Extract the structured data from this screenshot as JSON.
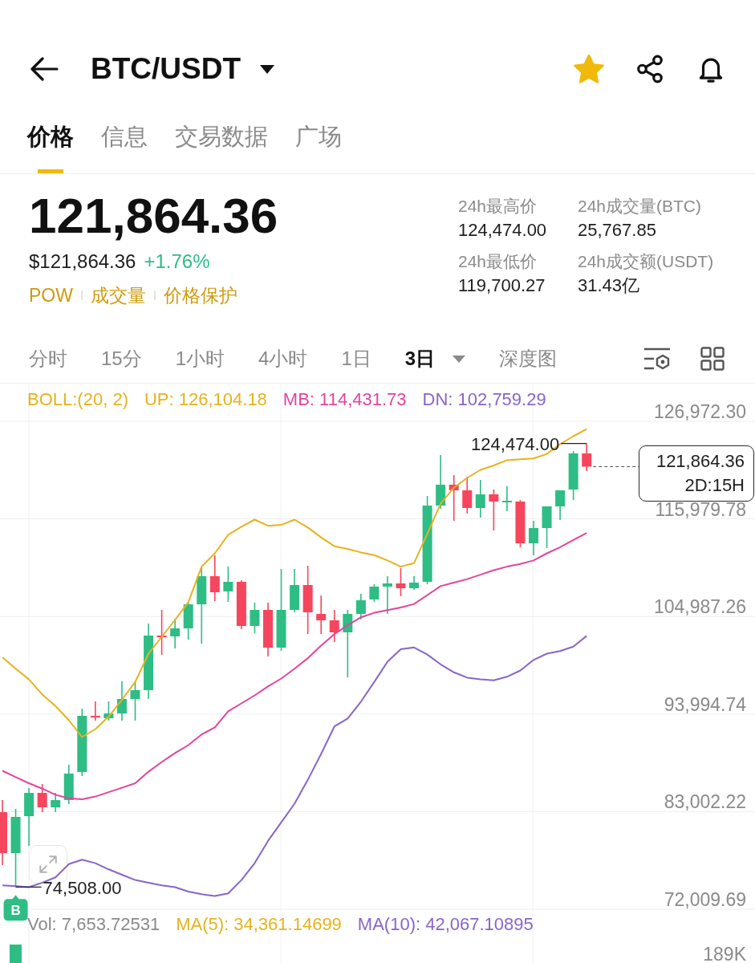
{
  "header": {
    "title": "BTC/USDT",
    "favorite": true
  },
  "tabs": [
    {
      "label": "价格",
      "selected": true
    },
    {
      "label": "信息",
      "selected": false
    },
    {
      "label": "交易数据",
      "selected": false
    },
    {
      "label": "广场",
      "selected": false
    }
  ],
  "ticker": {
    "price": "121,864.36",
    "fiat_price": "$121,864.36",
    "change": "+1.76%",
    "tags": [
      "POW",
      "成交量",
      "价格保护"
    ]
  },
  "stats": [
    {
      "label": "24h最高价",
      "value": "124,474.00"
    },
    {
      "label": "24h成交量(BTC)",
      "value": "25,767.85"
    },
    {
      "label": "24h最低价",
      "value": "119,700.27"
    },
    {
      "label": "24h成交额(USDT)",
      "value": "31.43亿"
    }
  ],
  "intervals": [
    {
      "label": "分时",
      "selected": false,
      "kind": "plain"
    },
    {
      "label": "15分",
      "selected": false,
      "kind": "plain"
    },
    {
      "label": "1小时",
      "selected": false,
      "kind": "plain"
    },
    {
      "label": "4小时",
      "selected": false,
      "kind": "plain"
    },
    {
      "label": "1日",
      "selected": false,
      "kind": "plain"
    },
    {
      "label": "3日",
      "selected": true,
      "kind": "dropdown"
    },
    {
      "label": "深度图",
      "selected": false,
      "kind": "plain"
    }
  ],
  "chart": {
    "chart_data": {
      "type": "candlestick",
      "title": "BOLL:(20, 2)",
      "grid": true,
      "ylim": [
        72009.69,
        126972.3
      ],
      "yticks": [
        {
          "value": 126972.3,
          "label": "126,972.30"
        },
        {
          "value": 115979.78,
          "label": "115,979.78"
        },
        {
          "value": 104987.26,
          "label": "104,987.26"
        },
        {
          "value": 93994.74,
          "label": "93,994.74"
        },
        {
          "value": 83002.22,
          "label": "83,002.22"
        },
        {
          "value": 72009.69,
          "label": "72,009.69"
        }
      ],
      "ohlc": [
        [
          82947,
          84303,
          76981,
          78337
        ],
        [
          78337,
          83309,
          74508,
          82405
        ],
        [
          82495,
          85659,
          79150,
          85117
        ],
        [
          85117,
          86111,
          82947,
          83490
        ],
        [
          83490,
          85117,
          82947,
          84303
        ],
        [
          84303,
          88281,
          83851,
          87286
        ],
        [
          87467,
          94609,
          87015,
          93795
        ],
        [
          93795,
          95422,
          93253,
          93614
        ],
        [
          93524,
          95422,
          93253,
          94066
        ],
        [
          94066,
          97682,
          93253,
          95694
        ],
        [
          95694,
          97682,
          93253,
          96688
        ],
        [
          96688,
          104191,
          95694,
          102835
        ],
        [
          102835,
          105728,
          100666,
          102654
        ],
        [
          102745,
          104734,
          101389,
          103649
        ],
        [
          103649,
          106542,
          102383,
          106361
        ],
        [
          106361,
          110610,
          101931,
          109525
        ],
        [
          109525,
          111875,
          106722,
          107717
        ],
        [
          107807,
          110610,
          106632,
          108892
        ],
        [
          108892,
          109073,
          103558,
          103920
        ],
        [
          103920,
          106542,
          103106,
          105728
        ],
        [
          105728,
          106542,
          100485,
          101479
        ],
        [
          101479,
          110338,
          101118,
          105728
        ],
        [
          105728,
          110338,
          105457,
          108530
        ],
        [
          108530,
          110700,
          103016,
          105457
        ],
        [
          105276,
          107355,
          103016,
          104553
        ],
        [
          104553,
          105728,
          102112,
          103197
        ],
        [
          103197,
          105728,
          98134,
          105276
        ],
        [
          105276,
          107536,
          104643,
          106813
        ],
        [
          106903,
          108621,
          106632,
          108350
        ],
        [
          108350,
          109525,
          105276,
          108711
        ],
        [
          108711,
          110429,
          107265,
          108169
        ],
        [
          108169,
          109525,
          107988,
          108802
        ],
        [
          108892,
          118565,
          108621,
          117480
        ],
        [
          117480,
          123175,
          117118,
          119830
        ],
        [
          119830,
          120915,
          115762,
          119198
        ],
        [
          119198,
          120734,
          116576,
          117209
        ],
        [
          117209,
          120373,
          116124,
          118746
        ],
        [
          118746,
          119288,
          114678,
          117932
        ],
        [
          117842,
          119650,
          116847,
          118022
        ],
        [
          117932,
          118100,
          112779,
          113231
        ],
        [
          113231,
          115762,
          111875,
          114949
        ],
        [
          114949,
          117390,
          112689,
          117390
        ],
        [
          117390,
          119198,
          115853,
          119198
        ],
        [
          119288,
          123627,
          118113,
          123356
        ],
        [
          123356,
          124474,
          121367,
          121864.36
        ]
      ],
      "series": [
        {
          "name": "UP: 126,104.18",
          "type": "line",
          "color": "#e6b31e",
          "values": [
            100400,
            99100,
            97900,
            96200,
            94900,
            93300,
            91400,
            92300,
            93700,
            95600,
            97600,
            100800,
            102700,
            104600,
            106600,
            110600,
            112100,
            114200,
            115100,
            115900,
            115200,
            115300,
            115900,
            115000,
            113900,
            112900,
            112600,
            112200,
            111900,
            111300,
            110600,
            111000,
            114300,
            117700,
            119500,
            120600,
            121500,
            122000,
            122600,
            122700,
            122800,
            123300,
            124400,
            125300,
            126100
          ]
        },
        {
          "name": "MB: 114,431.73",
          "type": "line",
          "color": "#e0459f",
          "values": [
            87600,
            86900,
            86200,
            85600,
            84900,
            84500,
            84400,
            84700,
            85200,
            85700,
            86200,
            87500,
            88600,
            89600,
            90500,
            91700,
            92500,
            94300,
            95200,
            96100,
            97100,
            98000,
            99100,
            100300,
            101700,
            103000,
            104000,
            104900,
            105400,
            105700,
            106000,
            106400,
            107400,
            108400,
            108800,
            109200,
            109700,
            110200,
            110600,
            110900,
            111300,
            112100,
            112800,
            113600,
            114400
          ]
        },
        {
          "name": "DN: 102,759.29",
          "type": "line",
          "color": "#8865c8",
          "values": [
            74700,
            74600,
            74500,
            75000,
            75600,
            77100,
            77600,
            77200,
            76500,
            75900,
            75300,
            75000,
            74700,
            74500,
            74000,
            73700,
            73500,
            73800,
            75300,
            77200,
            79700,
            81800,
            83900,
            86600,
            89500,
            92600,
            93500,
            95400,
            97600,
            99900,
            101300,
            101500,
            100700,
            99600,
            98700,
            98100,
            97900,
            97800,
            98200,
            98900,
            100100,
            100800,
            101100,
            101600,
            102800
          ]
        }
      ]
    },
    "high_label": "124,474.00",
    "low_label": "74,508.00",
    "last_price": {
      "price": "121,864.36",
      "countdown": "2D:15H"
    },
    "trade_marker": "B"
  },
  "volume": {
    "legend": [
      {
        "text": "Vol: 7,653.72531",
        "color": "#8a8a8a"
      },
      {
        "text": "MA(5): 34,361.14699",
        "color": "#e6b31e"
      },
      {
        "text": "MA(10): 42,067.10895",
        "color": "#8865c8"
      }
    ],
    "axis_label": "189K"
  }
}
